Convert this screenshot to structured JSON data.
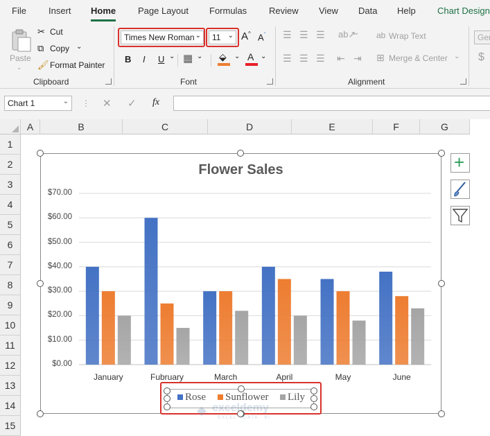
{
  "ribbon_tabs": [
    "File",
    "Insert",
    "Home",
    "Page Layout",
    "Formulas",
    "Review",
    "View",
    "Data",
    "Help",
    "Chart Design"
  ],
  "active_tab": "Home",
  "clipboard": {
    "paste_label": "Paste",
    "cut_label": "Cut",
    "copy_label": "Copy",
    "format_painter_label": "Format Painter",
    "group_label": "Clipboard"
  },
  "font": {
    "font_name": "Times New Roman",
    "font_size": "11",
    "bold": "B",
    "italic": "I",
    "underline": "U",
    "group_label": "Font"
  },
  "alignment": {
    "wrap_text_label": "Wrap Text",
    "merge_label": "Merge & Center",
    "group_label": "Alignment"
  },
  "number": {
    "format_value": "Gen",
    "currency_symbol": "$"
  },
  "formula_bar": {
    "name_box": "Chart 1",
    "fx_label": "fx",
    "value": ""
  },
  "sheet": {
    "columns": [
      "A",
      "B",
      "C",
      "D",
      "E",
      "F",
      "G"
    ],
    "rows": [
      "1",
      "2",
      "3",
      "4",
      "5",
      "6",
      "7",
      "8",
      "9",
      "10",
      "11",
      "12",
      "13",
      "14",
      "15"
    ]
  },
  "watermark": {
    "name": "exceldemy",
    "tagline": "EXCEL · DATA · BI"
  },
  "chart_data": {
    "type": "bar",
    "title": "Flower Sales",
    "categories": [
      "January",
      "Fubruary",
      "March",
      "April",
      "May",
      "June"
    ],
    "series": [
      {
        "name": "Rose",
        "color": "#4472c4",
        "values": [
          40,
          60,
          30,
          40,
          35,
          38
        ]
      },
      {
        "name": "Sunflower",
        "color": "#ed7d31",
        "values": [
          30,
          25,
          30,
          35,
          30,
          28
        ]
      },
      {
        "name": "Lily",
        "color": "#a5a5a5",
        "values": [
          20,
          15,
          22,
          20,
          18,
          23
        ]
      }
    ],
    "yticks": [
      "$0.00",
      "$10.00",
      "$20.00",
      "$30.00",
      "$40.00",
      "$50.00",
      "$60.00",
      "$70.00"
    ],
    "ylim": [
      0,
      70
    ],
    "grid": true,
    "legend": "bottom"
  }
}
